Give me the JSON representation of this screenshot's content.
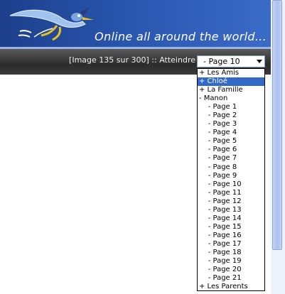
{
  "header": {
    "tagline": "Online all around the world...",
    "logo_icon": "roadrunner-logo-icon"
  },
  "toolbar": {
    "image_counter": "[Image 135 sur 300]",
    "separator": "::",
    "goto_label": "Atteindre",
    "select_value": "- Page 10"
  },
  "dropdown": {
    "options": [
      {
        "label": "+ Les Amis"
      },
      {
        "label": "+ Chloé"
      },
      {
        "label": "+ La Famille"
      },
      {
        "label": "- Manon"
      },
      {
        "label": "    - Page 1"
      },
      {
        "label": "    - Page 2"
      },
      {
        "label": "    - Page 3"
      },
      {
        "label": "    - Page 4"
      },
      {
        "label": "    - Page 5"
      },
      {
        "label": "    - Page 6"
      },
      {
        "label": "    - Page 7"
      },
      {
        "label": "    - Page 8"
      },
      {
        "label": "    - Page 9"
      },
      {
        "label": "    - Page 10"
      },
      {
        "label": "    - Page 11"
      },
      {
        "label": "    - Page 12"
      },
      {
        "label": "    - Page 13"
      },
      {
        "label": "    - Page 14"
      },
      {
        "label": "    - Page 15"
      },
      {
        "label": "    - Page 16"
      },
      {
        "label": "    - Page 17"
      },
      {
        "label": "    - Page 18"
      },
      {
        "label": "    - Page 19"
      },
      {
        "label": "    - Page 20"
      },
      {
        "label": "    - Page 21"
      },
      {
        "label": "+ Les Parents"
      }
    ],
    "highlighted_index": 1
  },
  "colors": {
    "header_blue": "#2855ad",
    "highlight": "#3169c6"
  }
}
